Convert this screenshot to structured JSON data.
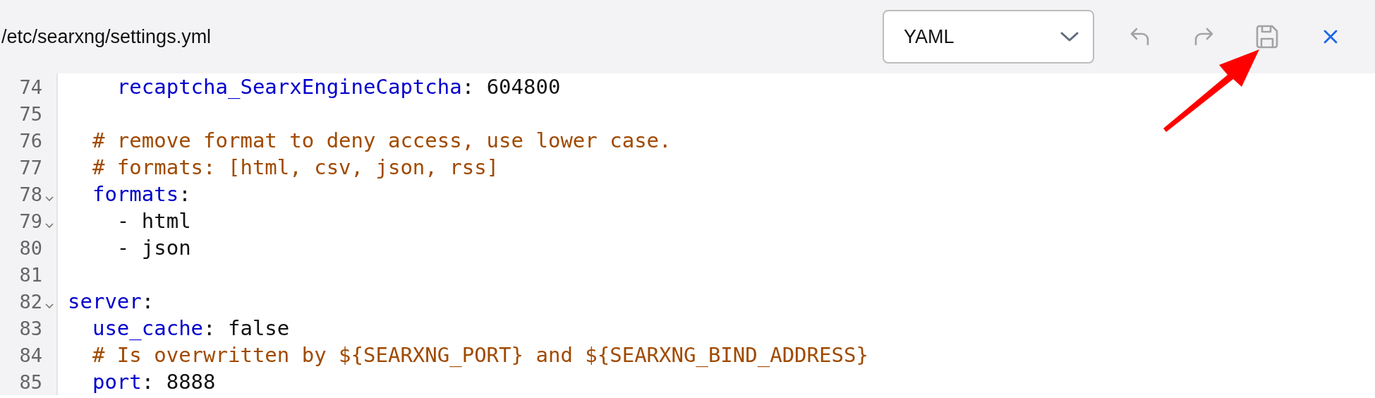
{
  "file_path": "/etc/searxng/settings.yml",
  "language_select": {
    "value": "YAML"
  },
  "toolbar": [
    {
      "kind": "undo"
    },
    {
      "kind": "redo"
    },
    {
      "kind": "save"
    },
    {
      "kind": "close"
    }
  ],
  "lines": [
    {
      "number": "74",
      "foldable": false,
      "tokens": [
        {
          "kind": "key",
          "text": "    recaptcha_SearxEngineCaptcha"
        },
        {
          "kind": "punct",
          "text": ": "
        },
        {
          "kind": "value",
          "text": "604800"
        }
      ]
    },
    {
      "number": "75",
      "foldable": false
    },
    {
      "number": "76",
      "foldable": false,
      "tokens": [
        {
          "kind": "comment",
          "text": "  # remove format to deny access, use lower case."
        }
      ]
    },
    {
      "number": "77",
      "foldable": false,
      "tokens": [
        {
          "kind": "comment",
          "text": "  # formats: [html, csv, json, rss]"
        }
      ]
    },
    {
      "number": "78",
      "foldable": true,
      "tokens": [
        {
          "kind": "key",
          "text": "  formats"
        },
        {
          "kind": "punct",
          "text": ":"
        }
      ]
    },
    {
      "number": "79",
      "foldable": true,
      "tokens": [
        {
          "kind": "value",
          "text": "    - html"
        }
      ]
    },
    {
      "number": "80",
      "foldable": false,
      "tokens": [
        {
          "kind": "value",
          "text": "    - json"
        }
      ]
    },
    {
      "number": "81",
      "foldable": false
    },
    {
      "number": "82",
      "foldable": true,
      "tokens": [
        {
          "kind": "key",
          "text": "server"
        },
        {
          "kind": "punct",
          "text": ":"
        }
      ]
    },
    {
      "number": "83",
      "foldable": false,
      "tokens": [
        {
          "kind": "key",
          "text": "  use_cache"
        },
        {
          "kind": "punct",
          "text": ": "
        },
        {
          "kind": "value",
          "text": "false"
        }
      ]
    },
    {
      "number": "84",
      "foldable": false,
      "tokens": [
        {
          "kind": "comment",
          "text": "  # Is overwritten by ${SEARXNG_PORT} and ${SEARXNG_BIND_ADDRESS}"
        }
      ]
    },
    {
      "number": "85",
      "foldable": false,
      "tokens": [
        {
          "kind": "key",
          "text": "  port"
        },
        {
          "kind": "punct",
          "text": ": "
        },
        {
          "kind": "value",
          "text": "8888"
        }
      ]
    }
  ]
}
